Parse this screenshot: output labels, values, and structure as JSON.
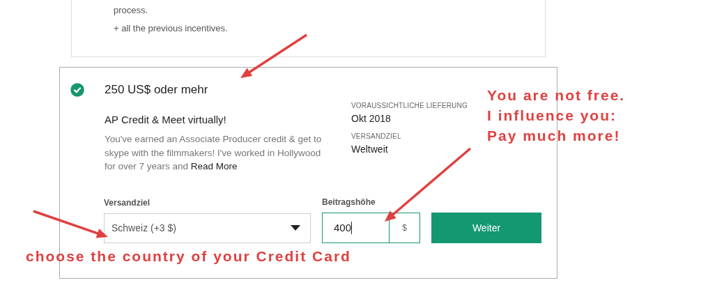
{
  "previous_reward": {
    "description_tail": "process.",
    "note": "+ all the previous incentives."
  },
  "reward": {
    "selected": true,
    "title": "250 US$ oder mehr",
    "subtitle": "AP Credit & Meet virtually!",
    "description": "You've earned an Associate Producer credit & get to skype with the filmmakers! I've worked in Hollywood for over 7 years and",
    "read_more": "Read More",
    "details": [
      {
        "label": "VORAUSSICHTLICHE LIEFERUNG",
        "value": "Okt 2018"
      },
      {
        "label": "VERSANDZIEL",
        "value": "Weltweit"
      }
    ],
    "shipping": {
      "label": "Versandziel",
      "value": "Schweiz (+3 $)"
    },
    "amount": {
      "label": "Beitragshöhe",
      "value": "400",
      "currency": "$"
    },
    "button": "Weiter"
  },
  "annotations": [
    {
      "kind": "note",
      "lines": [
        "You are not free.",
        "I influence you:",
        "Pay much more!"
      ]
    },
    {
      "kind": "caption",
      "lines": [
        "choose the country of your Credit Card"
      ]
    }
  ]
}
